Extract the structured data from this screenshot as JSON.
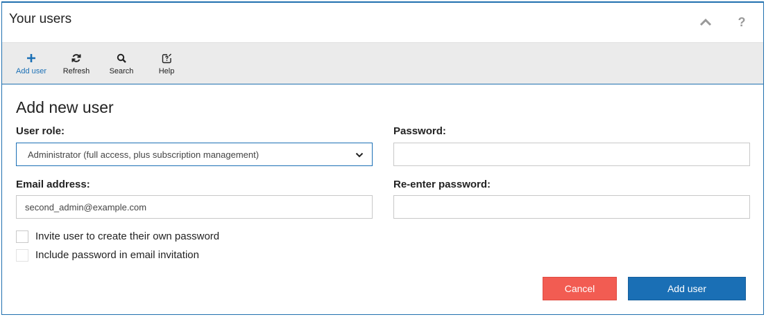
{
  "header": {
    "title": "Your users"
  },
  "toolbar": {
    "items": [
      {
        "label": "Add user",
        "icon": "plus-icon"
      },
      {
        "label": "Refresh",
        "icon": "refresh-icon"
      },
      {
        "label": "Search",
        "icon": "search-icon"
      },
      {
        "label": "Help",
        "icon": "help-edit-icon"
      }
    ]
  },
  "form": {
    "title": "Add new user",
    "user_role_label": "User role:",
    "user_role_value": "Administrator (full access, plus subscription management)",
    "password_label": "Password:",
    "password_value": "",
    "email_label": "Email address:",
    "email_value": "second_admin@example.com",
    "reenter_label": "Re-enter password:",
    "reenter_value": "",
    "invite_label": "Invite user to create their own password",
    "include_label": "Include password in email invitation",
    "cancel_label": "Cancel",
    "submit_label": "Add user"
  },
  "colors": {
    "accent": "#1a6fb5",
    "danger": "#f25c52",
    "toolbar_bg": "#ebebeb"
  }
}
